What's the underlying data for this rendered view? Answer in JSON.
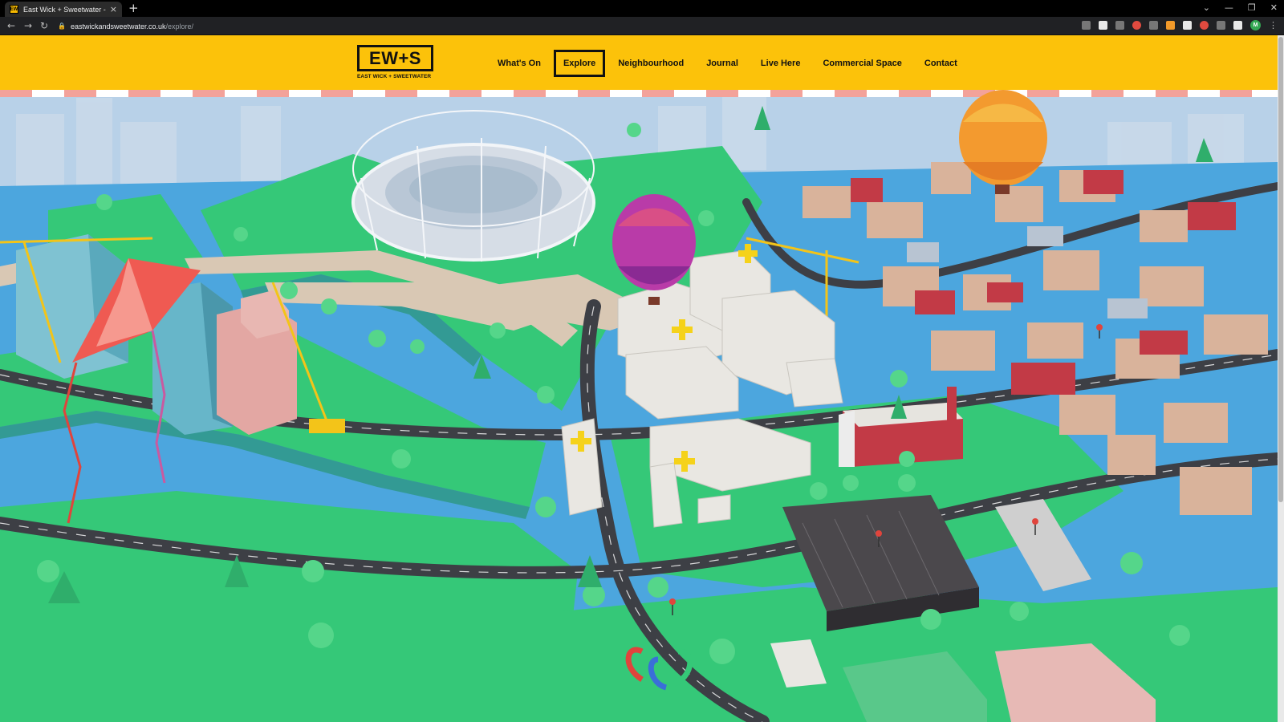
{
  "browser": {
    "tab_title": "East Wick + Sweetwater - explore",
    "tab_close": "×",
    "new_tab": "+",
    "favicon_text": "EW",
    "url_host": "eastwickandsweetwater.co.uk",
    "url_path": "/explore/",
    "nav_back": "←",
    "nav_forward": "→",
    "nav_reload": "↻",
    "window_controls": [
      "⌄",
      "—",
      "❐",
      "✕"
    ],
    "profile_initial": "M"
  },
  "site": {
    "logo_mark": "EW+S",
    "logo_subtitle": "EAST WICK + SWEETWATER",
    "brand_yellow": "#fcc20a",
    "nav": [
      {
        "label": "What's On",
        "active": false
      },
      {
        "label": "Explore",
        "active": true
      },
      {
        "label": "Neighbourhood",
        "active": false
      },
      {
        "label": "Journal",
        "active": false
      },
      {
        "label": "Live Here",
        "active": false
      },
      {
        "label": "Commercial Space",
        "active": false
      },
      {
        "label": "Contact",
        "active": false
      }
    ]
  },
  "map": {
    "description_icons": [
      "stadium",
      "hot-air-balloon",
      "kite",
      "crane",
      "map-plus-marker",
      "location-pin"
    ],
    "colors": {
      "water": "#4ca6de",
      "grass": "#35c878",
      "road": "#3d3f45",
      "path": "#d9c8b4",
      "building_light": "#e9e7e2",
      "building_red": "#c23a46",
      "marker": "#f5d21a"
    }
  }
}
